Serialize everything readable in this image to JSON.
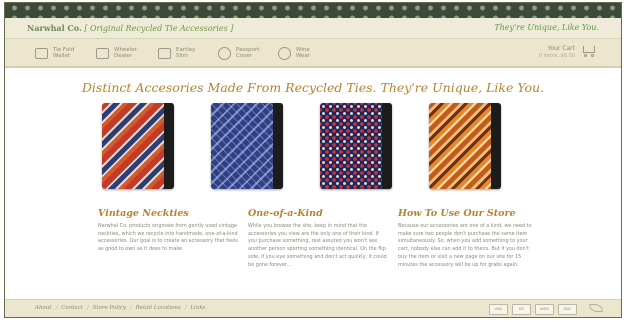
{
  "header": {
    "brand_name": "Narwhal Co.",
    "brand_sub": "[ Original Recycled Tie Accessories ]",
    "tagline": "They're Unique, Like You."
  },
  "nav": {
    "items": [
      {
        "label": "Tie Fold\nWallet",
        "icon": "wallet-icon"
      },
      {
        "label": "Wheeler\nDealer",
        "icon": "card-icon"
      },
      {
        "label": "Eartley\nSlim",
        "icon": "slim-wallet-icon"
      },
      {
        "label": "Passport\nCover",
        "icon": "passport-icon"
      },
      {
        "label": "Wine\nWear",
        "icon": "wine-icon"
      }
    ],
    "cart": {
      "title": "Your Cart",
      "subtitle": "0 items, $0.00",
      "icon": "cart-icon"
    }
  },
  "main": {
    "headline": "Distinct Accesories Made From Recycled Ties. They're Unique, Like You.",
    "products": [
      {
        "name": "red-striped-tie-wallet",
        "colors": [
          "#c13a2a",
          "#2e3c78",
          "#e4dccc"
        ]
      },
      {
        "name": "blue-paisley-tie-wallet",
        "colors": [
          "#2d3f86",
          "#c8d2eb"
        ]
      },
      {
        "name": "navy-patterned-tie-wallet",
        "colors": [
          "#1d2566",
          "#c0392b",
          "#e7d7b8"
        ]
      },
      {
        "name": "orange-striped-tie-wallet",
        "colors": [
          "#c45b1a",
          "#e9c27a",
          "#7a2c14"
        ]
      }
    ],
    "columns": [
      {
        "title": "Vintage Neckties",
        "body": "Narwhal Co. products originate from gently used vintage neckties, which we recycle into handmade, one-of-a-kind accessories. Our goal is to create an accessory that feels as good to own as it does to make."
      },
      {
        "title": "One-of-a-Kind",
        "body": "While you browse the site, keep in mind that the accessories you view are the only one of their kind. If you purchase something, rest assured you won't see another person sporting something identical. On the flip side, if you eye something and don't act quickly, it could be gone forever..."
      },
      {
        "title": "How To Use Our Store",
        "body": "Because our accessories are one of a kind, we need to make sure two people don't purchase the same item simultaneously. So, when you add something to your cart, nobody else can add it to theirs. But if you don't buy the item or visit a new page on our site for 15 minutes the accessory will be up for grabs again."
      }
    ]
  },
  "footer": {
    "links": [
      "About",
      "Contact",
      "Store Policy",
      "Retail Locations",
      "Links"
    ],
    "payment_cards": [
      "VISA",
      "MC",
      "AMEX",
      "DISC"
    ]
  },
  "colors": {
    "accent_gold": "#b5832f",
    "brand_green": "#5e9b3d",
    "band_dark_green": "#3c4a39",
    "nav_bg": "#ece6cf"
  }
}
